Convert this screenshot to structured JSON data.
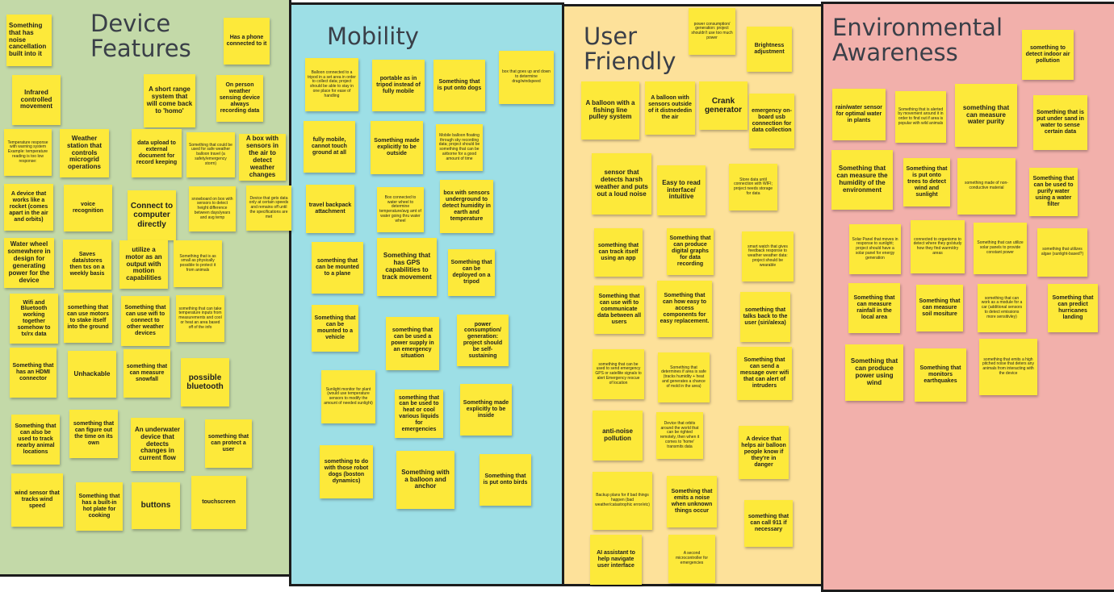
{
  "colors": {
    "device_features": "#c3d9a8",
    "mobility": "#9ddfe6",
    "user_friendly": "#fde19a",
    "environmental_awareness": "#f2b0ab",
    "sticky_note": "#fde93a",
    "border": "#1c1c1c"
  },
  "panels": {
    "device_features": "Device\nFeatures",
    "mobility": "Mobility",
    "user_friendly": "User\nFriendly",
    "environmental_awareness": "Environmental\nAwareness"
  },
  "notes": {
    "df01": "Something that has noise cancellation built into it",
    "df02": "Has a phone connected to it",
    "df03": "Infrared controlled movement",
    "df04": "A short range system that will come back to 'homo'",
    "df05": "On person weather sensing device always recording data",
    "df06": "Temperature response with warning system Example: temperature reading is too low response:",
    "df07": "Weather station that controls microgrid operations",
    "df08": "data upload to external document for record keeping",
    "df09": "Something that could be used for safe weather balloon travel (a safety/emergency storm)",
    "df10": "A box with sensors in the air to detect weather changes",
    "df11": "A device that works like a rocket (comes apart in the air and orbits)",
    "df12": "voice recognition",
    "df13": "Connect to computer directly",
    "df14": "snowboard on box with sensors to detect height difference between days/years and avg temp",
    "df15": "Device that gets data only at certain speeds and remains off until the specifications are met",
    "df16": "Water wheel somewhere in design for generating power for the device",
    "df17": "Saves data/stores then txs on a weekly basis",
    "df18": "utilize a motor as an output with motion capabilities",
    "df19": "Something that is as small as physically possible to protect it from animals",
    "df20": "Wifi and Bluetooth working together somehow to tx/rx data",
    "df21": "something that can use motors to stake itself into the ground",
    "df22": "Something that can use wifi to connect to other weather devices",
    "df23": "something that can take temperature inputs from measurements and cool or heat an area based off of the info",
    "df24": "Something that has an HDMI connector",
    "df25": "Unhackable",
    "df26": "something that can measure snowfall",
    "df27": "possible bluetooth",
    "df28": "Something that can also be used to track nearby animal locations",
    "df29": "something that can figure out the time on its own",
    "df30": "An underwater device that detects changes in current flow",
    "df31": "something that can protect a user",
    "df32": "wind sensor that tracks wind speed",
    "df33": "Something that has a built-in hot plate for cooking",
    "df34": "buttons",
    "df35": "touchscreen",
    "mo01": "Balloon connected to a tripod in a set area in order to collect data; project should be able to stay in one place for ease of handling",
    "mo02": "portable as in tripod instead of fully mobile",
    "mo03": "Something that is put onto dogs",
    "mo04": "box that goes up and down to determine drag/windspeed",
    "mo05": "fully mobile, cannot touch ground at all",
    "mo06": "Something made explicitly to be outside",
    "mo07": "Mobile balloon floating through sky recording data; project should be something that can be airborne for a good amount of time",
    "mo08": "travel backpack attachment",
    "mo09": "Box connected to water wheel to determine temperature/avg amt of water going thru water wheel",
    "mo10": "box with sensors underground to detect humidity in earth and temperature",
    "mo11": "something that can be mounted to a plane",
    "mo12": "Something that has GPS capabilities to track movement",
    "mo13": "Something that can be deployed on a tripod",
    "mo14": "Something that can be mounted to a vehicle",
    "mo15": "something that can be used a power supply in an emergency situation",
    "mo16": "power consumption/ generation: project should be self-sustaining",
    "mo17": "Sunlight monitor for plant (would use temperature sensors to modify the amount of needed sunlight)",
    "mo18": "something that can be used to heat or cool various liquids for emergencies",
    "mo19": "Something made explicitly to be inside",
    "mo20": "something to do with those robot dogs (boston dynamics)",
    "mo21": "Something with a balloon and anchor",
    "mo22": "Something that is put onto birds",
    "uf01": "power consumption/ generation: project shouldn't use too much power",
    "uf02": "Brightness adjustment",
    "uf03": "A balloon with a fishing line pulley system",
    "uf04": "A balloon with sensors outside of it distnededin the air",
    "uf05": "Crank generator",
    "uf06": "emergency on-board usb connection for data collection",
    "uf07": "sensor that detects harsh weather and puts out a loud noise",
    "uf08": "Easy to read interface/ intuitive",
    "uf09": "Store data until connection with WIFI; project needs storage for data",
    "uf10": "something that can track itself using an app",
    "uf11": "Something that can produce digital graphs for data recording",
    "uf12": "smart watch that gives feedback response to weather weather data: project should be wearable",
    "uf13": "Something that can use wifi to communicate data between all users",
    "uf14": "Something that can how easy to access components for easy replacement.",
    "uf15": "something that talks back to the user (siri/alexa)",
    "uf16": "something that can be used to send emergency GPS or satellite signals to alert Emergency rescue of location",
    "uf17": "Something that determines if area is safe (tracks humidity + heat and generates a chance of mold in the area)",
    "uf18": "Something that can send a message over wifi that can alert of intruders",
    "uf19": "anti-noise pollution",
    "uf20": "Device that orbits around the world that can be righted remotely, then when it comes to 'home' transmits data",
    "uf21": "A device that helps air balloon people know if they're in danger",
    "uf22": "Backup plans for if bad things happen (bad weather/catastrophic error/etc)",
    "uf23": "Something that emits a noise when unknown things occur",
    "uf24": "something that can call 911 if necessary",
    "uf25": "AI assistant to help navigate user interface",
    "uf26": "A second microcontroller for emergencies",
    "ea01": "something to detect indoor air pollution",
    "ea02": "rain/water sensor for optimal water in plants",
    "ea03": "Something that is alerted by movement around it in order to find out if area is popular with wild animals",
    "ea04": "something that can measure water purity",
    "ea05": "Something that is put under sand in water to sense certain data",
    "ea06": "Something that can measure the humidity of the environment",
    "ea07": "Something that is put onto trees to detect wind and sunlight",
    "ea08": "something made of non-conductive material",
    "ea09": "Something that can be used to purify water using a water filter",
    "ea10": "Solar Panel that moves in response to sunlight; project should have a solar panel for energy generation",
    "ea11": "connected to organisms to detect where they go/study how they find warm/dry areas",
    "ea12": "Something that can utilize solar panels to provide constant power",
    "ea13": "something that utilizes algae (sunlight-based?)",
    "ea14": "Something that can measure rainfall in the local area",
    "ea15": "Something that can measure soil mositure",
    "ea16": "something that can work as a module for a car (additional sensors to detect emissions more sensitivley)",
    "ea17": "Something that can predict hurricanes landing",
    "ea18": "Something that can produce power using wind",
    "ea19": "Something that monitors earthquakes",
    "ea20": "something that emits a high pitched noise that deters any animals from interacting with the device"
  }
}
